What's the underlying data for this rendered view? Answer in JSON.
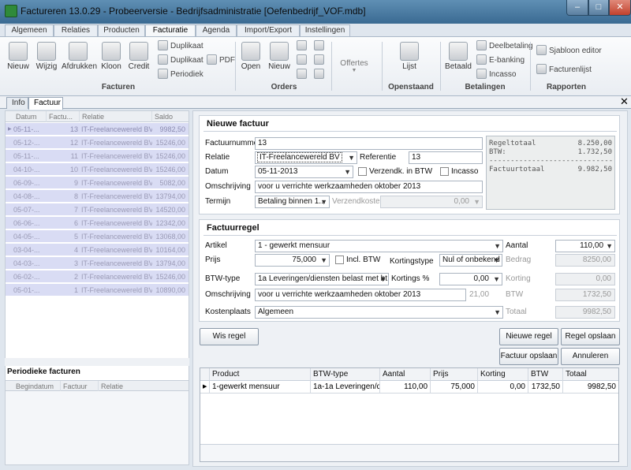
{
  "window": {
    "title": "Factureren 13.0.29 - Probeerversie - Bedrijfsadministratie [Oefenbedrijf_VOF.mdb]",
    "minimize": "–",
    "maximize": "□",
    "close": "✕"
  },
  "ribbon_tabs": [
    "Algemeen",
    "Relaties",
    "Producten",
    "Facturatie",
    "Agenda",
    "Import/Export",
    "Instellingen"
  ],
  "ribbon": {
    "facturen": {
      "group": "Facturen",
      "nieuw": "Nieuw",
      "wijzig": "Wijzig",
      "afdrukken": "Afdrukken",
      "kloon": "Kloon",
      "credit": "Credit",
      "duplikaat1": "Duplikaat",
      "duplikaat2": "Duplikaat",
      "periodiek": "Periodiek",
      "pdf": "PDF"
    },
    "orders": {
      "group": "Orders",
      "open": "Open",
      "nieuw": "Nieuw"
    },
    "offertes": {
      "label": "Offertes"
    },
    "openstaand": {
      "group": "Openstaand",
      "lijst": "Lijst"
    },
    "betalingen": {
      "group": "Betalingen",
      "betaald": "Betaald",
      "deelbetaling": "Deelbetaling",
      "ebanking": "E-banking",
      "incasso": "Incasso"
    },
    "rapporten": {
      "group": "Rapporten",
      "sjabloon": "Sjabloon editor",
      "facturenlijst": "Facturenlijst"
    }
  },
  "doc_tabs": [
    "Info",
    "Factuur"
  ],
  "doc_close": "✕",
  "left_grid": {
    "headers": [
      "Datum",
      "Factu...",
      "Relatie",
      "Saldo"
    ],
    "rows": [
      {
        "datum": "05-11-...",
        "nr": "13",
        "relatie": "IT-Freelancewereld BV",
        "saldo": "9982,50"
      },
      {
        "datum": "05-12-...",
        "nr": "12",
        "relatie": "IT-Freelancewereld BV",
        "saldo": "15246,00"
      },
      {
        "datum": "05-11-...",
        "nr": "11",
        "relatie": "IT-Freelancewereld BV",
        "saldo": "15246,00"
      },
      {
        "datum": "04-10-...",
        "nr": "10",
        "relatie": "IT-Freelancewereld BV",
        "saldo": "15246,00"
      },
      {
        "datum": "06-09-...",
        "nr": "9",
        "relatie": "IT-Freelancewereld BV",
        "saldo": "5082,00"
      },
      {
        "datum": "04-08-...",
        "nr": "8",
        "relatie": "IT-Freelancewereld BV",
        "saldo": "13794,00"
      },
      {
        "datum": "05-07-...",
        "nr": "7",
        "relatie": "IT-Freelancewereld BV",
        "saldo": "14520,00"
      },
      {
        "datum": "06-06-...",
        "nr": "6",
        "relatie": "IT-Freelancewereld BV",
        "saldo": "12342,00"
      },
      {
        "datum": "04-05-...",
        "nr": "5",
        "relatie": "IT-Freelancewereld BV",
        "saldo": "13068,00"
      },
      {
        "datum": "03-04-...",
        "nr": "4",
        "relatie": "IT-Freelancewereld BV",
        "saldo": "10164,00"
      },
      {
        "datum": "04-03-...",
        "nr": "3",
        "relatie": "IT-Freelancewereld BV",
        "saldo": "13794,00"
      },
      {
        "datum": "06-02-...",
        "nr": "2",
        "relatie": "IT-Freelancewereld BV",
        "saldo": "15246,00"
      },
      {
        "datum": "05-01-...",
        "nr": "1",
        "relatie": "IT-Freelancewereld BV",
        "saldo": "10890,00"
      }
    ]
  },
  "periodiek": {
    "title": "Periodieke facturen",
    "headers": [
      "Begindatum",
      "Factuur",
      "Relatie"
    ]
  },
  "factuur": {
    "title": "Nieuwe factuur",
    "factuurnummer_label": "Factuurnummer",
    "factuurnummer": "13",
    "relatie_label": "Relatie",
    "relatie": "IT-Freelancewereld BV",
    "referentie_label": "Referentie",
    "referentie": "13",
    "datum_label": "Datum",
    "datum": "05-11-2013",
    "verzendk_label": "Verzendk. in BTW",
    "incasso_label": "Incasso",
    "omschrijving_label": "Omschrijving",
    "omschrijving": "voor u verrichte werkzaamheden oktober 2013",
    "termijn_label": "Termijn",
    "termijn": "Betaling binnen 1...",
    "verzendkosten_label": "Verzendkosten",
    "verzendkosten": "0,00"
  },
  "totals": {
    "regeltotaal_label": "Regeltotaal",
    "regeltotaal": "8.250,00",
    "btw_label": "BTW:",
    "btw": "1.732,50",
    "divider": "-----------------------------",
    "factuurtotaal_label": "Factuurtotaal",
    "factuurtotaal": "9.982,50"
  },
  "regel": {
    "title": "Factuurregel",
    "artikel_label": "Artikel",
    "artikel": "1 - gewerkt mensuur",
    "aantal_label": "Aantal",
    "aantal": "110,00",
    "prijs_label": "Prijs",
    "prijs": "75,000",
    "incl_btw_label": "Incl. BTW",
    "kortingstype_label": "Kortingstype",
    "kortingstype": "Nul of onbekend",
    "bedrag_label": "Bedrag",
    "bedrag": "8250,00",
    "btwtype_label": "BTW-type",
    "btwtype": "1a Leveringen/diensten belast met bt...",
    "kortingspct_label": "Kortings %",
    "kortingspct": "0,00",
    "korting_label": "Korting",
    "korting": "0,00",
    "omschrijving_label": "Omschrijving",
    "omschrijving": "voor u verrichte werkzaamheden oktober 2013",
    "btw_bedrag": "21,00",
    "btw_label": "BTW",
    "btw": "1732,50",
    "kostenplaats_label": "Kostenplaats",
    "kostenplaats": "Algemeen",
    "totaal_label": "Totaal",
    "totaal": "9982,50"
  },
  "buttons": {
    "wis_regel": "Wis regel",
    "nieuwe_regel": "Nieuwe regel",
    "regel_opslaan": "Regel opslaan",
    "factuur_opslaan": "Factuur opslaan",
    "annuleren": "Annuleren"
  },
  "lines_grid": {
    "headers": [
      "Product",
      "BTW-type",
      "Aantal",
      "Prijs",
      "Korting",
      "BTW",
      "Totaal"
    ],
    "rows": [
      {
        "product": "1-gewerkt mensuur",
        "btwtype": "1a-1a Leveringen/d...",
        "aantal": "110,00",
        "prijs": "75,000",
        "korting": "0,00",
        "btw": "1732,50",
        "totaal": "9982,50"
      }
    ]
  }
}
